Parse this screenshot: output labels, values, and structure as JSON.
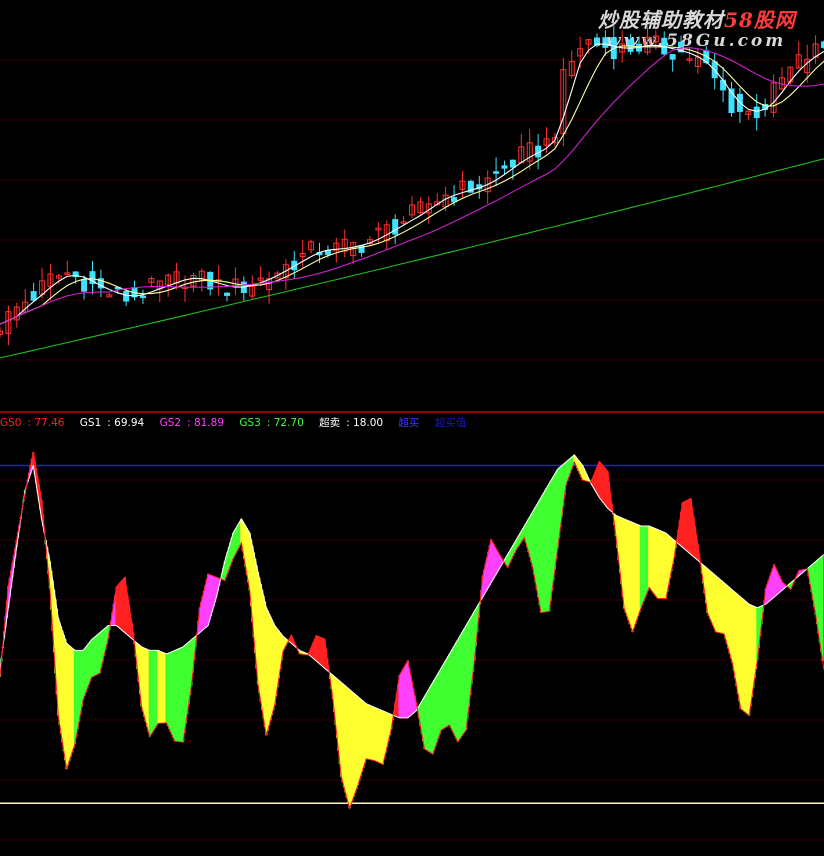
{
  "watermark": {
    "line1_text": "炒股辅助教材",
    "line1_num": "58股网",
    "line2": "www.58Gu.com"
  },
  "legend": [
    {
      "label": "GS0",
      "value": "77.46",
      "color": "#ff2020"
    },
    {
      "label": "GS1",
      "value": "69.94",
      "color": "#ffffff"
    },
    {
      "label": "GS2",
      "value": "81.89",
      "color": "#ff40ff"
    },
    {
      "label": "GS3",
      "value": "72.70",
      "color": "#40ff40"
    },
    {
      "label": "超卖",
      "value": "18.00",
      "color": "#ffffff"
    },
    {
      "label": "超买",
      "value": "",
      "color": "#3a3aff"
    },
    {
      "label": "超买值",
      "value": "",
      "color": "#1818c8"
    }
  ],
  "colors": {
    "background": "#000000",
    "divider": "#c00000",
    "grid": "#300000",
    "candle_up": "#ff3030",
    "candle_down": "#40e0ff",
    "ma_short": "#ffffff",
    "ma_mid": "#ffffa0",
    "ma_long": "#cc22cc",
    "ma_longest": "#20c020",
    "overbought_line": "#2020d0",
    "oversold_line": "#fff6c0",
    "bar_yellow": "#ffff30",
    "bar_red": "#ff2020",
    "bar_magenta": "#ff40ff",
    "bar_green": "#40ff30"
  },
  "chart_data": [
    {
      "type": "candlestick",
      "title": "",
      "price_series": [
        18,
        24,
        31,
        37,
        42,
        48,
        55,
        58,
        60,
        57,
        54,
        50,
        46,
        44,
        42,
        40,
        42,
        45,
        47,
        50,
        52,
        55,
        57,
        56,
        54,
        52,
        50,
        48,
        48,
        50,
        52,
        55,
        58,
        62,
        66,
        70,
        74,
        78,
        80,
        80,
        80,
        82,
        83,
        85,
        88,
        92,
        96,
        100,
        104,
        108,
        112,
        118,
        122,
        125,
        127,
        129,
        131,
        133,
        137,
        142,
        147,
        152,
        157,
        160,
        163,
        168,
        180,
        220,
        235,
        248,
        252,
        250,
        248,
        247,
        246,
        247,
        249,
        250,
        248,
        246,
        245,
        243,
        240,
        236,
        230,
        220,
        210,
        200,
        195,
        193,
        195,
        200,
        210,
        220,
        228,
        235,
        240,
        244,
        248
      ],
      "moving_averages": [
        "MA short",
        "MA mid",
        "MA long",
        "MA longest"
      ]
    },
    {
      "type": "bar",
      "title": "",
      "reference_lines": {
        "overbought": 95,
        "oversold": 0
      },
      "series_oscillator": [
        38,
        55,
        72,
        88,
        95,
        80,
        68,
        52,
        45,
        43,
        43,
        46,
        48,
        50,
        50,
        48,
        46,
        44,
        43,
        43,
        42,
        43,
        44,
        46,
        48,
        50,
        58,
        68,
        76,
        80,
        76,
        65,
        55,
        50,
        47,
        45,
        43,
        42,
        40,
        38,
        36,
        34,
        32,
        30,
        28,
        27,
        26,
        25,
        24,
        24,
        26,
        30,
        34,
        38,
        42,
        46,
        50,
        54,
        58,
        62,
        66,
        70,
        74,
        78,
        82,
        86,
        90,
        94,
        96,
        98,
        95,
        90,
        86,
        83,
        81,
        80,
        79,
        78,
        78,
        77,
        76,
        74,
        72,
        70,
        68,
        66,
        64,
        62,
        60,
        58,
        56,
        55,
        56,
        58,
        60,
        62,
        64,
        66,
        68,
        70
      ],
      "bar_sides": [
        "yellow",
        "red",
        "magenta",
        "green"
      ]
    }
  ]
}
